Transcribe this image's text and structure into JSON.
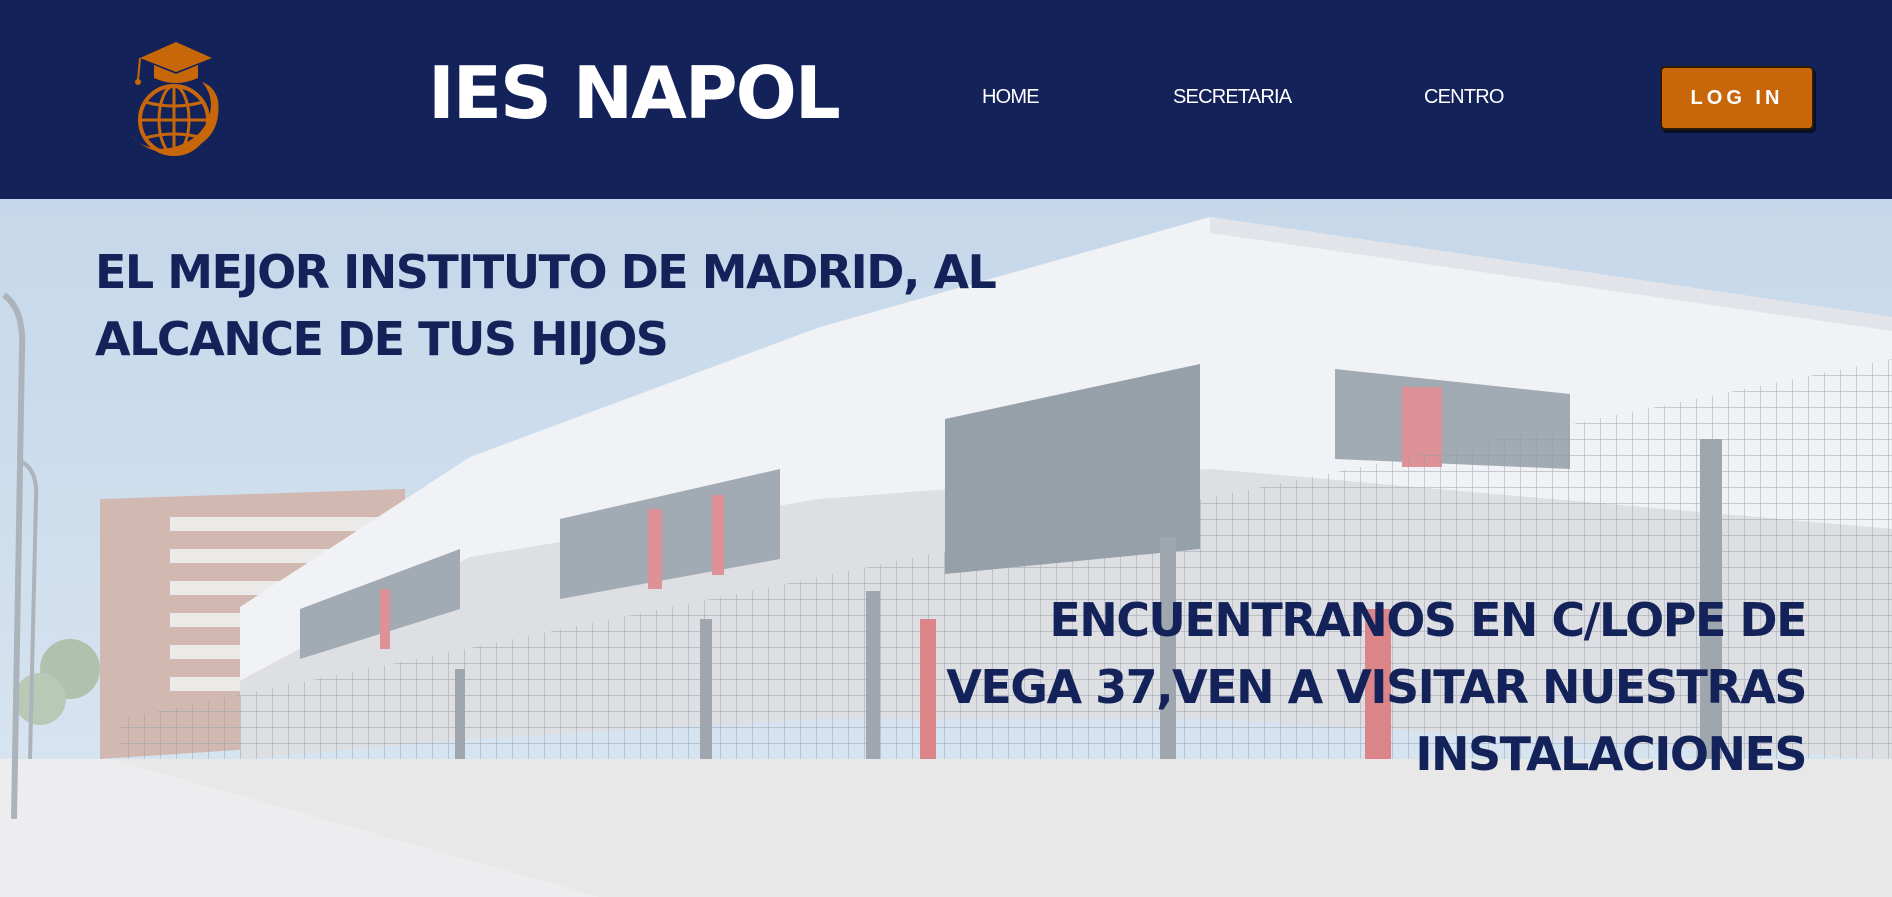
{
  "header": {
    "title": "IES NAPOL",
    "nav": [
      {
        "label": "HOME"
      },
      {
        "label": "SECRETARIA"
      },
      {
        "label": "CENTRO"
      }
    ],
    "login_label": "LOG IN",
    "logo_icon": "graduation-cap-globe-icon"
  },
  "hero": {
    "tagline": "EL MEJOR INSTITUTO DE MADRID, AL ALCANCE DE TUS HIJOS",
    "address": "ENCUENTRANOS EN C/LOPE DE VEGA 37,VEN A VISITAR NUESTRAS INSTALACIONES"
  },
  "colors": {
    "header_bg": "#14225a",
    "accent": "#c8670a",
    "text_dark": "#14225a",
    "white": "#ffffff"
  }
}
